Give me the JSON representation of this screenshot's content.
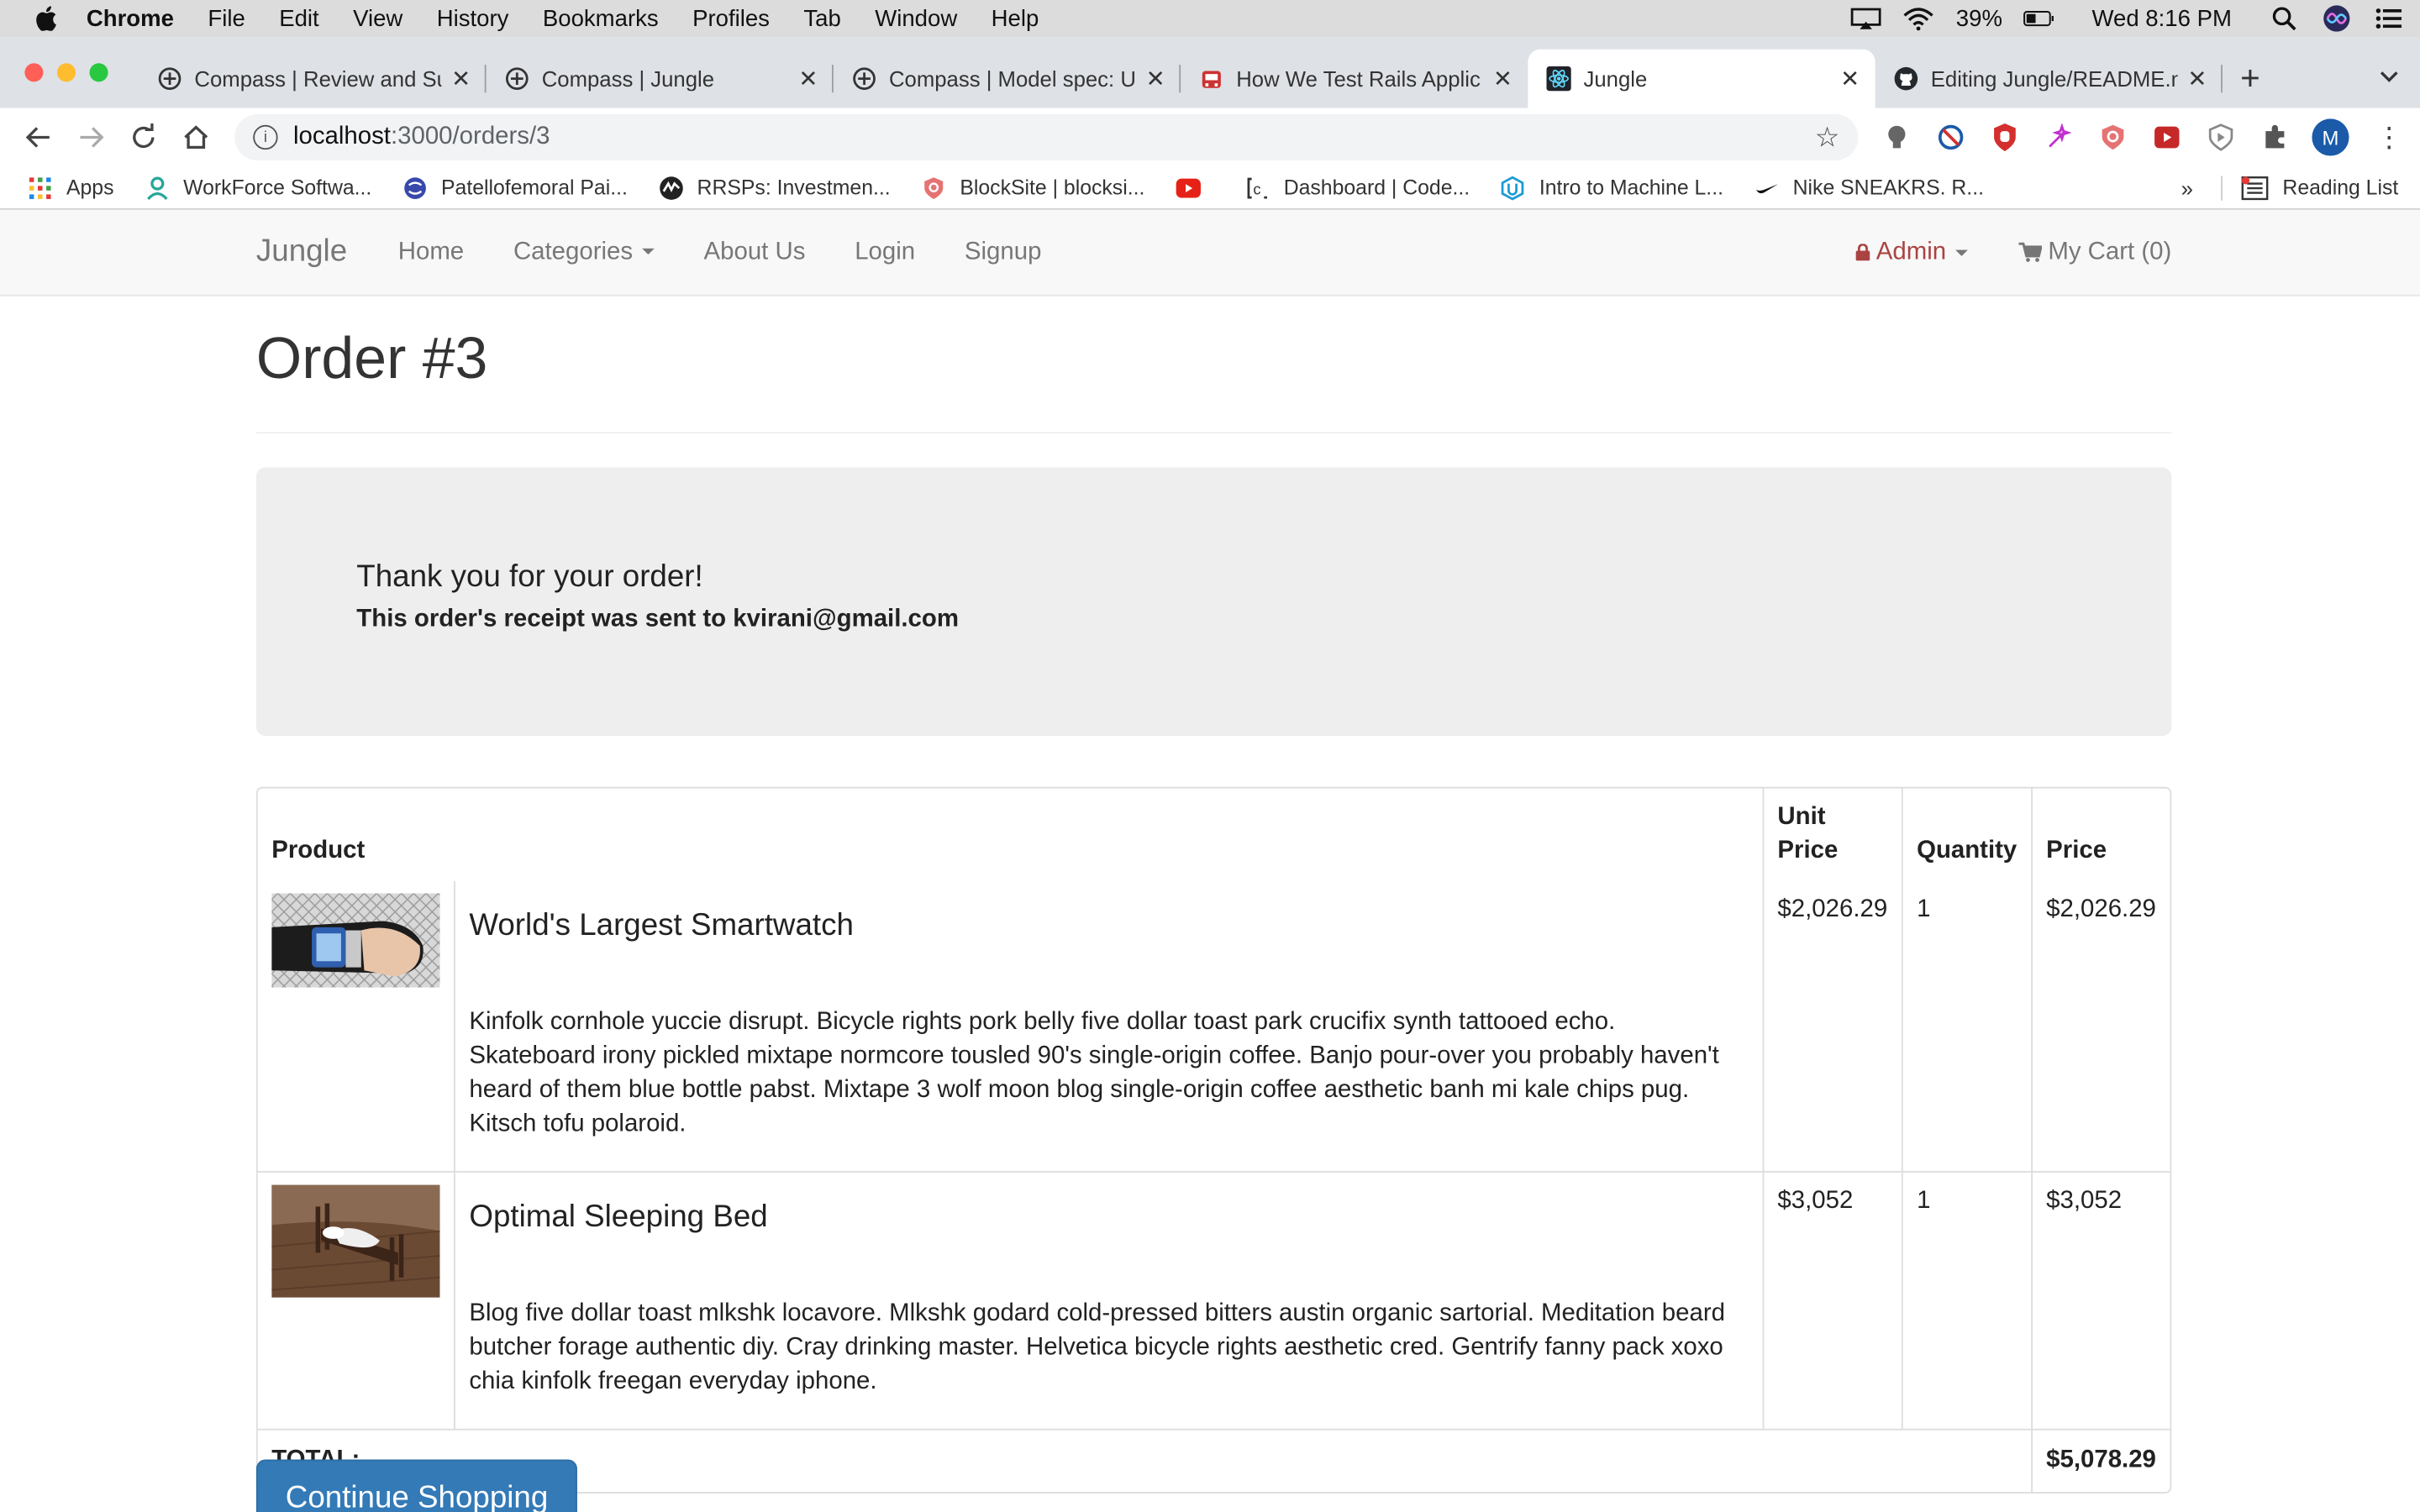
{
  "menubar": {
    "app": "Chrome",
    "items": [
      "File",
      "Edit",
      "View",
      "History",
      "Bookmarks",
      "Profiles",
      "Tab",
      "Window",
      "Help"
    ],
    "battery": "39%",
    "clock": "Wed 8:16 PM"
  },
  "tabs": [
    {
      "title": "Compass | Review and Su",
      "active": false
    },
    {
      "title": "Compass | Jungle",
      "active": false
    },
    {
      "title": "Compass | Model spec: U",
      "active": false
    },
    {
      "title": "How We Test Rails Applic",
      "active": false
    },
    {
      "title": "Jungle",
      "active": true
    },
    {
      "title": "Editing Jungle/README.m",
      "active": false
    }
  ],
  "omnibox": {
    "host": "localhost",
    "path": ":3000/orders/3"
  },
  "bookmarks": {
    "items": [
      "Apps",
      "WorkForce Softwa...",
      "Patellofemoral Pai...",
      "RRSPs: Investmen...",
      "BlockSite | blocksi...",
      "",
      "Dashboard | Code...",
      "Intro to Machine L...",
      "Nike SNEAKRS. R..."
    ],
    "more": "»",
    "reading_list": "Reading List"
  },
  "nav": {
    "brand": "Jungle",
    "links": [
      "Home",
      "Categories",
      "About Us",
      "Login",
      "Signup"
    ],
    "admin": "Admin",
    "cart": "My Cart (0)"
  },
  "page": {
    "title": "Order #3",
    "thanks": "Thank you for your order!",
    "receipt": "This order's receipt was sent to kvirani@gmail.com"
  },
  "table": {
    "headers": {
      "product": "Product",
      "unit_price": "Unit Price",
      "quantity": "Quantity",
      "price": "Price"
    },
    "rows": [
      {
        "name": "World's Largest Smartwatch",
        "description": "Kinfolk cornhole yuccie disrupt. Bicycle rights pork belly five dollar toast park crucifix synth tattooed echo. Skateboard irony pickled mixtape normcore tousled 90's single-origin coffee. Banjo pour-over you probably haven't heard of them blue bottle pabst. Mixtape 3 wolf moon blog single-origin coffee aesthetic banh mi kale chips pug. Kitsch tofu polaroid.",
        "unit_price": "$2,026.29",
        "quantity": "1",
        "price": "$2,026.29"
      },
      {
        "name": "Optimal Sleeping Bed",
        "description": "Blog five dollar toast mlkshk locavore. Mlkshk godard cold-pressed bitters austin organic sartorial. Meditation beard butcher forage authentic diy. Cray drinking master. Helvetica bicycle rights aesthetic cred. Gentrify fanny pack xoxo chia kinfolk freegan everyday iphone.",
        "unit_price": "$3,052",
        "quantity": "1",
        "price": "$3,052"
      }
    ],
    "total_label": "TOTAL:",
    "total": "$5,078.29"
  },
  "continue_button": "Continue Shopping",
  "colors": {
    "accent": "#337ab7",
    "admin": "#a94442",
    "jumbotron": "#eeeeee",
    "navbar": "#f8f8f8"
  }
}
